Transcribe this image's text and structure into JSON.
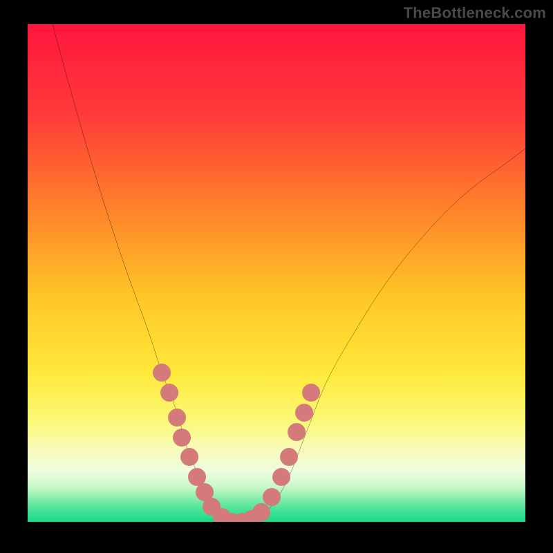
{
  "watermark": "TheBottleneck.com",
  "colors": {
    "frame_bg": "#000000",
    "watermark_text": "#4a4a4a",
    "curve": "#000000",
    "dot_fill": "#d47a7a",
    "gradient_stops": [
      {
        "offset": 0.0,
        "color": "#ff163d"
      },
      {
        "offset": 0.18,
        "color": "#ff3a3a"
      },
      {
        "offset": 0.35,
        "color": "#ff7a2b"
      },
      {
        "offset": 0.55,
        "color": "#ffc726"
      },
      {
        "offset": 0.7,
        "color": "#ffe93a"
      },
      {
        "offset": 0.8,
        "color": "#fbf97a"
      },
      {
        "offset": 0.86,
        "color": "#f8fbc0"
      },
      {
        "offset": 0.9,
        "color": "#ecfde1"
      },
      {
        "offset": 0.93,
        "color": "#c8f8c6"
      },
      {
        "offset": 0.95,
        "color": "#8fefb0"
      },
      {
        "offset": 0.97,
        "color": "#55e59c"
      },
      {
        "offset": 1.0,
        "color": "#16db88"
      }
    ]
  },
  "chart_data": {
    "type": "line",
    "title": "",
    "xlabel": "",
    "ylabel": "",
    "xlim": [
      0,
      100
    ],
    "ylim": [
      0,
      100
    ],
    "grid": false,
    "series": [
      {
        "name": "bottleneck-curve",
        "x": [
          5,
          8,
          12,
          16,
          20,
          24,
          27,
          30,
          32,
          34,
          36,
          38,
          40,
          42,
          45,
          48,
          52,
          56,
          60,
          65,
          72,
          80,
          88,
          96,
          100
        ],
        "y": [
          100,
          89,
          75,
          62,
          50,
          39,
          30,
          22,
          15,
          10,
          5,
          2,
          0,
          0,
          0,
          2,
          8,
          18,
          28,
          37,
          48,
          58,
          66,
          72,
          75
        ]
      }
    ],
    "highlight_dots": {
      "name": "sample-points",
      "radius_pct": 1.8,
      "points": [
        {
          "x": 27,
          "y": 30
        },
        {
          "x": 28.5,
          "y": 26
        },
        {
          "x": 30,
          "y": 21
        },
        {
          "x": 31,
          "y": 17
        },
        {
          "x": 32.5,
          "y": 13
        },
        {
          "x": 34,
          "y": 9
        },
        {
          "x": 35.5,
          "y": 6
        },
        {
          "x": 37,
          "y": 3
        },
        {
          "x": 39,
          "y": 1
        },
        {
          "x": 41,
          "y": 0
        },
        {
          "x": 43,
          "y": 0
        },
        {
          "x": 45,
          "y": 0.5
        },
        {
          "x": 47,
          "y": 2
        },
        {
          "x": 49,
          "y": 5
        },
        {
          "x": 51,
          "y": 9
        },
        {
          "x": 52.5,
          "y": 13
        },
        {
          "x": 54,
          "y": 18
        },
        {
          "x": 55.5,
          "y": 22
        },
        {
          "x": 57,
          "y": 26
        }
      ]
    }
  }
}
